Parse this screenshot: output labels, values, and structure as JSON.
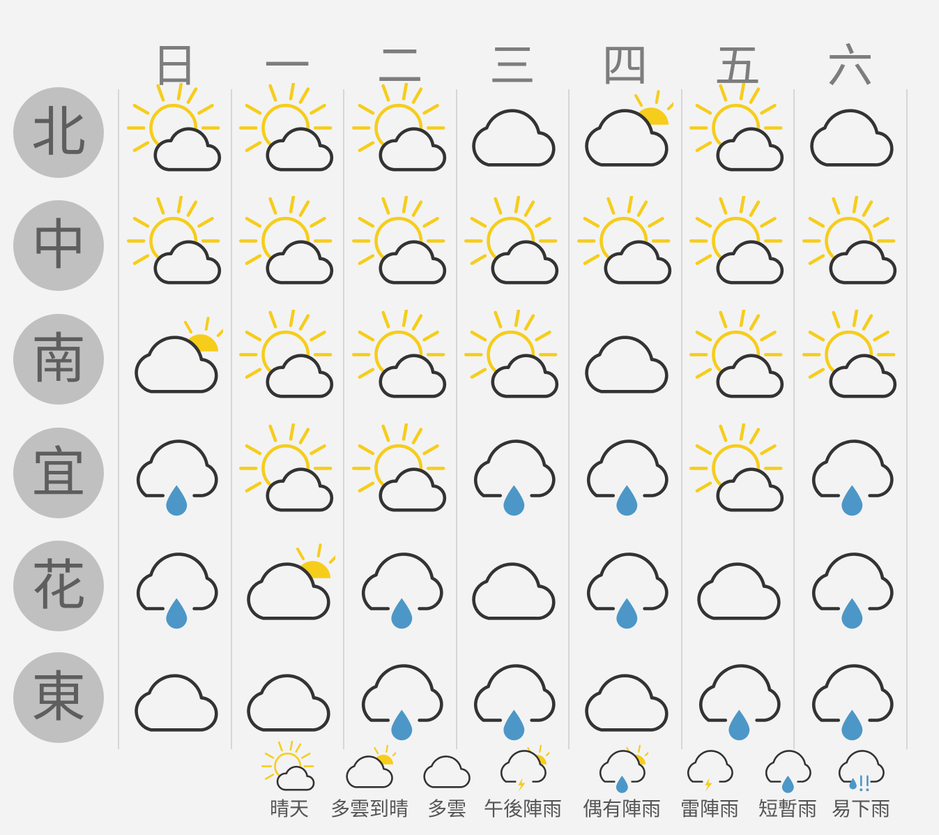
{
  "days": [
    "日",
    "一",
    "二",
    "三",
    "四",
    "五",
    "六"
  ],
  "regions": [
    "北",
    "中",
    "南",
    "宜",
    "花",
    "東"
  ],
  "forecast": [
    [
      "sunny-cloud-icon",
      "sunny-cloud-icon",
      "sunny-cloud-icon",
      "cloudy-icon",
      "cloud-sun-peek-icon",
      "sunny-cloud-icon",
      "cloudy-icon"
    ],
    [
      "sunny-cloud-icon",
      "sunny-cloud-icon",
      "sunny-cloud-icon",
      "sunny-cloud-icon",
      "sunny-cloud-icon",
      "sunny-cloud-icon",
      "sunny-cloud-icon"
    ],
    [
      "cloud-sun-peek-icon",
      "sunny-cloud-icon",
      "sunny-cloud-icon",
      "sunny-cloud-icon",
      "cloudy-icon",
      "sunny-cloud-icon",
      "sunny-cloud-icon"
    ],
    [
      "rain-icon",
      "sunny-cloud-icon",
      "sunny-cloud-icon",
      "rain-icon",
      "rain-icon",
      "sunny-cloud-icon",
      "rain-icon"
    ],
    [
      "rain-icon",
      "cloud-sun-peek-icon",
      "rain-icon",
      "cloudy-icon",
      "rain-icon",
      "cloudy-icon",
      "rain-icon"
    ],
    [
      "cloudy-icon",
      "cloudy-icon",
      "rain-icon",
      "rain-icon",
      "cloudy-icon",
      "rain-icon",
      "rain-icon"
    ]
  ],
  "legend": [
    {
      "icon": "sunny-cloud-icon",
      "label": "晴天"
    },
    {
      "icon": "cloud-sun-peek-icon",
      "label": "多雲到晴"
    },
    {
      "icon": "cloudy-icon",
      "label": "多雲"
    },
    {
      "icon": "afternoon-thunder-icon",
      "label": "午後陣雨"
    },
    {
      "icon": "occasional-shower-icon",
      "label": "偶有陣雨"
    },
    {
      "icon": "thunderstorm-icon",
      "label": "雷陣雨"
    },
    {
      "icon": "brief-rain-icon",
      "label": "短暫雨"
    },
    {
      "icon": "heavy-rain-icon",
      "label": "易下雨"
    }
  ],
  "colors": {
    "sun": "#f6cd1b",
    "cloud_stroke": "#333333",
    "rain": "#4c97c7",
    "circle": "#c0c0c0",
    "text": "#7d7d7d"
  }
}
